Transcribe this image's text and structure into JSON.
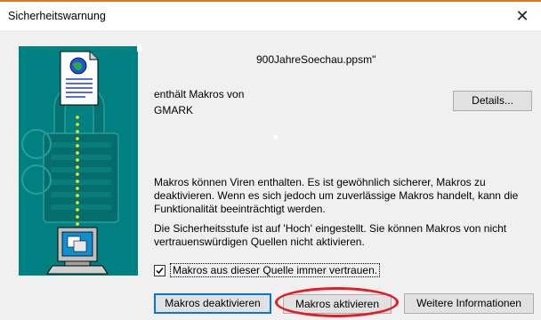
{
  "window": {
    "title": "Sicherheitswarnung",
    "close_glyph": "✕"
  },
  "dialog": {
    "filename": "900JahreSoechau.ppsm\"",
    "macros_from_label": "enthält Makros von",
    "publisher": "GMARK",
    "details_button": "Details...",
    "warning_text": "Makros können Viren enthalten. Es ist gewöhnlich sicherer, Makros zu deaktivieren. Wenn es sich jedoch um zuverlässige Makros handelt, kann die Funktionalität beeinträchtigt werden.",
    "security_level_text": "Die Sicherheitsstufe ist auf 'Hoch' eingestellt. Sie können Makros von nicht vertrauenswürdigen Quellen nicht aktivieren.",
    "trust_checkbox": {
      "label": "Makros aus dieser Quelle immer vertrauen.",
      "checked": true
    },
    "buttons": {
      "deactivate": "Makros deaktivieren",
      "activate": "Makros aktivieren",
      "more_info": "Weitere Informationen"
    }
  },
  "icons": {
    "close": "close-icon",
    "certificate": "certificate-document-icon",
    "lock": "padlock-icon",
    "computer": "computer-icon",
    "checkmark": "checkmark-icon"
  },
  "colors": {
    "art_background": "#008080",
    "highlight_oval": "#e51c23",
    "focus_border": "#0078d7",
    "accent_line": "#d9782b"
  }
}
